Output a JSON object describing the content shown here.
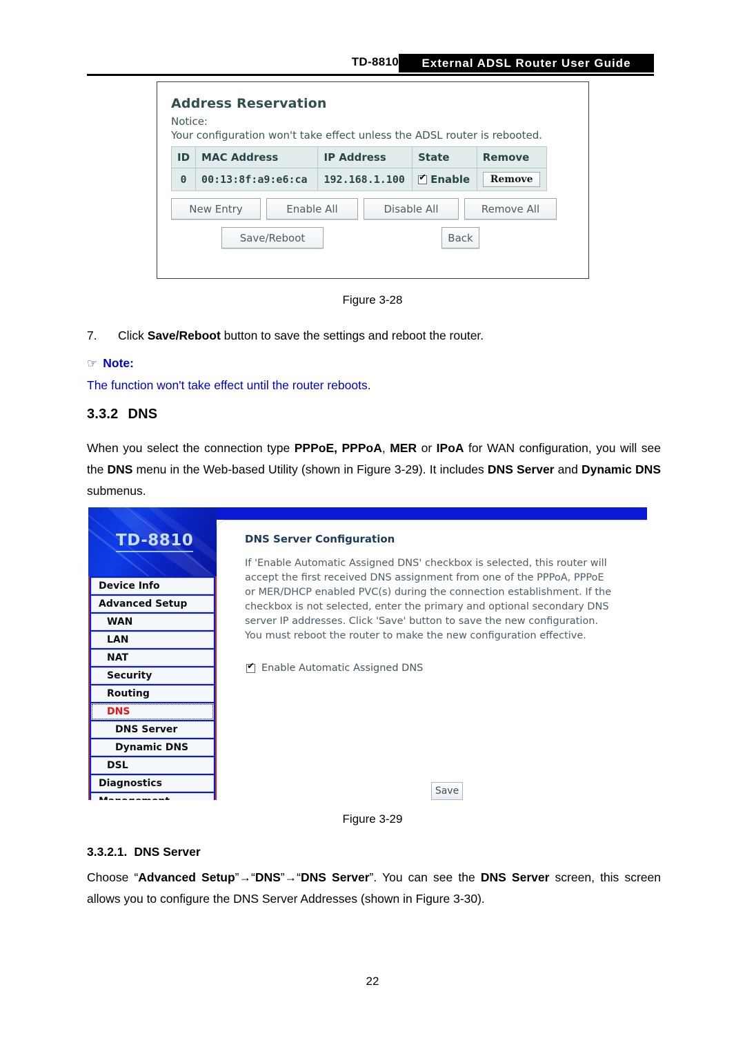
{
  "header": {
    "model": "TD-8810",
    "banner_title": "External ADSL Router User Guide"
  },
  "figure_28": {
    "caption": "Figure 3-28",
    "panel_title": "Address Reservation",
    "notice_label": "Notice:",
    "notice_text": "Your configuration won't take effect unless the ADSL router is rebooted.",
    "table": {
      "columns": [
        "ID",
        "MAC Address",
        "IP Address",
        "State",
        "Remove"
      ],
      "rows": [
        {
          "id": "0",
          "mac": "00:13:8f:a9:e6:ca",
          "ip": "192.168.1.100",
          "state_label": "Enable",
          "state_checked": true,
          "remove_label": "Remove"
        }
      ]
    },
    "buttons_row1": [
      "New Entry",
      "Enable All",
      "Disable All",
      "Remove All"
    ],
    "buttons_row2": [
      "Save/Reboot",
      "Back"
    ]
  },
  "step_7": {
    "number": "7.",
    "text_before": "Click ",
    "bold": "Save/Reboot",
    "text_after": " button to save the settings and reboot the router."
  },
  "note": {
    "hand_icon": "☞",
    "label": "Note:",
    "text": "The function won't take effect until the router reboots."
  },
  "section_332": {
    "number": "3.3.2",
    "title": "DNS",
    "paragraph": {
      "p1": "When you select the connection type ",
      "b1": "PPPoE, PPPoA",
      "p2": ", ",
      "b2": "MER",
      "p3": " or ",
      "b3": "IPoA",
      "p4": " for WAN configuration, you will see the ",
      "b4": "DNS",
      "p5": " menu in the Web-based Utility (shown in Figure 3-29). It includes ",
      "b5": "DNS Server",
      "p6": " and ",
      "b6": "Dynamic DNS",
      "p7": " submenus."
    }
  },
  "figure_29": {
    "caption": "Figure 3-29",
    "brand": "TD-8810",
    "sidebar": [
      {
        "label": "Device Info",
        "level": 1,
        "active": false
      },
      {
        "label": "Advanced Setup",
        "level": 1,
        "active": false
      },
      {
        "label": "WAN",
        "level": 2,
        "active": false
      },
      {
        "label": "LAN",
        "level": 2,
        "active": false
      },
      {
        "label": "NAT",
        "level": 2,
        "active": false
      },
      {
        "label": "Security",
        "level": 2,
        "active": false
      },
      {
        "label": "Routing",
        "level": 2,
        "active": false
      },
      {
        "label": "DNS",
        "level": 2,
        "active": true
      },
      {
        "label": "DNS Server",
        "level": 3,
        "active": false
      },
      {
        "label": "Dynamic DNS",
        "level": 3,
        "active": false
      },
      {
        "label": "DSL",
        "level": 2,
        "active": false
      },
      {
        "label": "Diagnostics",
        "level": 1,
        "active": false
      },
      {
        "label": "Management",
        "level": 1,
        "active": false
      }
    ],
    "content": {
      "title": "DNS Server Configuration",
      "body": "If 'Enable Automatic Assigned DNS' checkbox is selected, this router will accept the first received DNS assignment from one of the PPPoA, PPPoE or MER/DHCP enabled PVC(s) during the connection establishment. If the checkbox is not selected, enter the primary and optional secondary DNS server IP addresses. Click 'Save' button to save the new configuration. You must reboot the router to make the new configuration effective.",
      "checkbox_label": "Enable Automatic Assigned DNS",
      "checkbox_checked": true,
      "save_label": "Save"
    }
  },
  "section_3321": {
    "number": "3.3.2.1.",
    "title": "DNS Server",
    "paragraph": {
      "p1": "Choose “",
      "b1": "Advanced Setup",
      "p2": "”→“",
      "b2": "DNS",
      "p3": "”→“",
      "b3": "DNS Server",
      "p4": "”. You can see the ",
      "b4": "DNS Server",
      "p5": " screen, this screen allows you to configure the DNS Server Addresses (shown in Figure 3-30)."
    }
  },
  "page_number": "22",
  "colors": {
    "banner_black": "#000000",
    "note_blue": "#0000cc",
    "nav_blue": "#0a18d8",
    "nav_active_red": "#ee1111",
    "table_cell": "#e3ecec"
  }
}
